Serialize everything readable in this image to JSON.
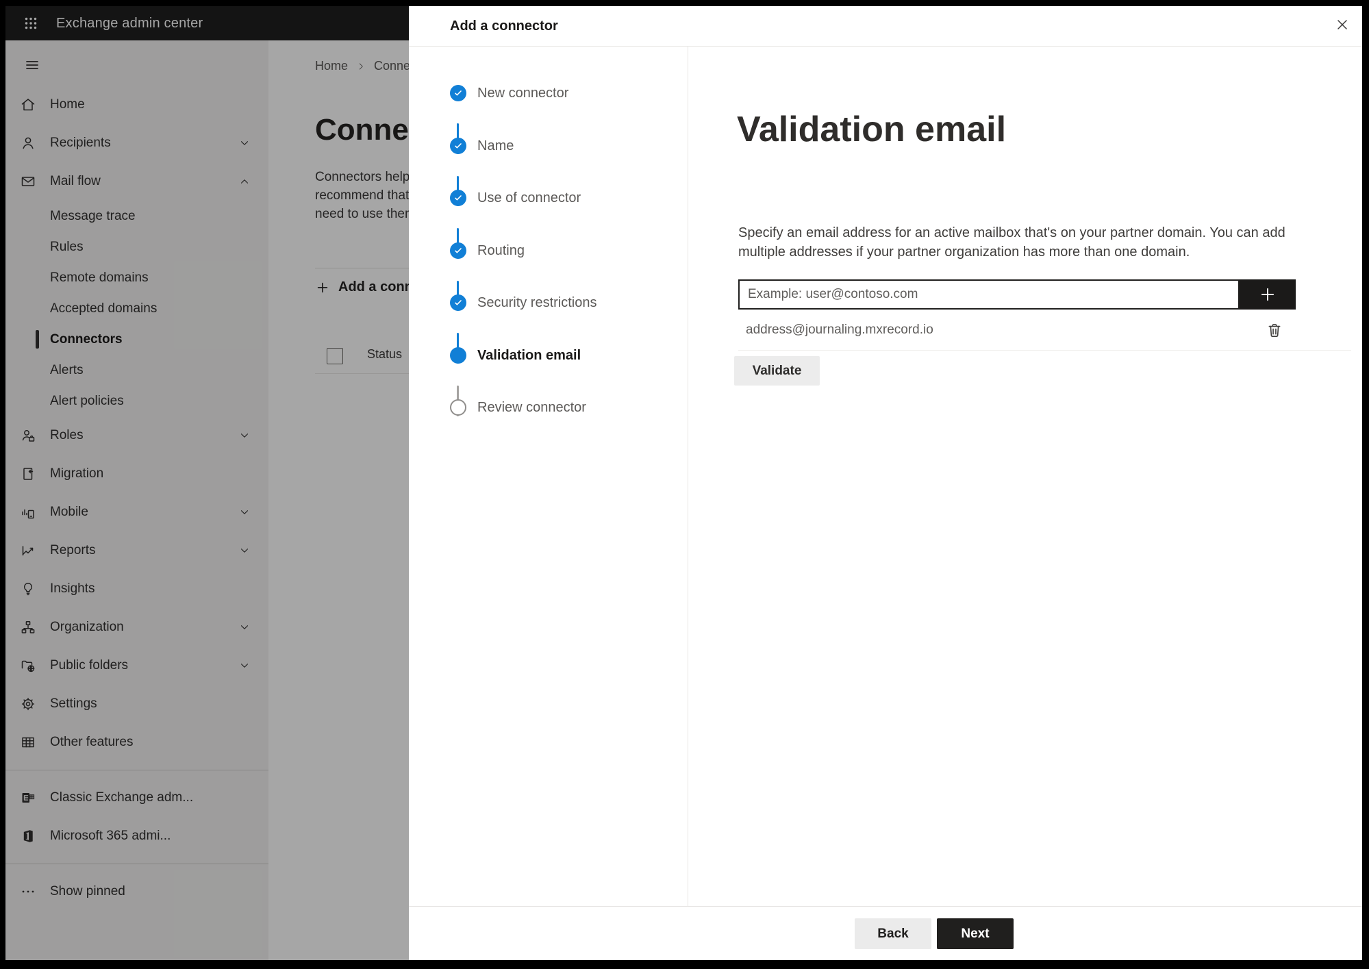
{
  "header": {
    "title": "Exchange admin center"
  },
  "sidebar": {
    "items": [
      {
        "label": "Home"
      },
      {
        "label": "Recipients"
      },
      {
        "label": "Mail flow"
      },
      {
        "label": "Message trace"
      },
      {
        "label": "Rules"
      },
      {
        "label": "Remote domains"
      },
      {
        "label": "Accepted domains"
      },
      {
        "label": "Connectors"
      },
      {
        "label": "Alerts"
      },
      {
        "label": "Alert policies"
      },
      {
        "label": "Roles"
      },
      {
        "label": "Migration"
      },
      {
        "label": "Mobile"
      },
      {
        "label": "Reports"
      },
      {
        "label": "Insights"
      },
      {
        "label": "Organization"
      },
      {
        "label": "Public folders"
      },
      {
        "label": "Settings"
      },
      {
        "label": "Other features"
      },
      {
        "label": "Classic Exchange adm..."
      },
      {
        "label": "Microsoft 365 admi..."
      },
      {
        "label": "Show pinned"
      }
    ]
  },
  "content": {
    "breadcrumb_home": "Home",
    "breadcrumb_current": "Connectors",
    "title": "Connectors",
    "desc_line1": "Connectors help",
    "desc_line2": "recommend that",
    "desc_line3": "need to use them",
    "add_button": "Add a connector",
    "status_header": "Status"
  },
  "panel": {
    "title": "Add a connector",
    "steps": [
      {
        "label": "New connector",
        "state": "done"
      },
      {
        "label": "Name",
        "state": "done"
      },
      {
        "label": "Use of connector",
        "state": "done"
      },
      {
        "label": "Routing",
        "state": "done"
      },
      {
        "label": "Security restrictions",
        "state": "done"
      },
      {
        "label": "Validation email",
        "state": "current"
      },
      {
        "label": "Review connector",
        "state": "todo"
      }
    ],
    "page": {
      "heading": "Validation email",
      "description_line1": "Specify an email address for an active mailbox that's on your partner domain. You can add",
      "description_line2": "multiple addresses if your partner organization has more than one domain.",
      "input_placeholder": "Example: user@contoso.com",
      "input_value": "",
      "address": "address@journaling.mxrecord.io",
      "validate_label": "Validate"
    },
    "footer": {
      "back_label": "Back",
      "next_label": "Next"
    }
  },
  "icons": {
    "app_launcher": "3x3-dot-grid",
    "hamburger": "three-lines",
    "close": "x-mark",
    "add": "plus",
    "delete": "trash-can",
    "step_done": "check-in-blue-circle"
  },
  "colors": {
    "accent_blue": "#117fd6",
    "header_bg": "#1f1f1f",
    "sidebar_bg": "#f3f2f1",
    "dark_button": "#201f1e",
    "neutral_button": "#ececec",
    "overlay": "rgba(0,0,0,0.35)"
  }
}
